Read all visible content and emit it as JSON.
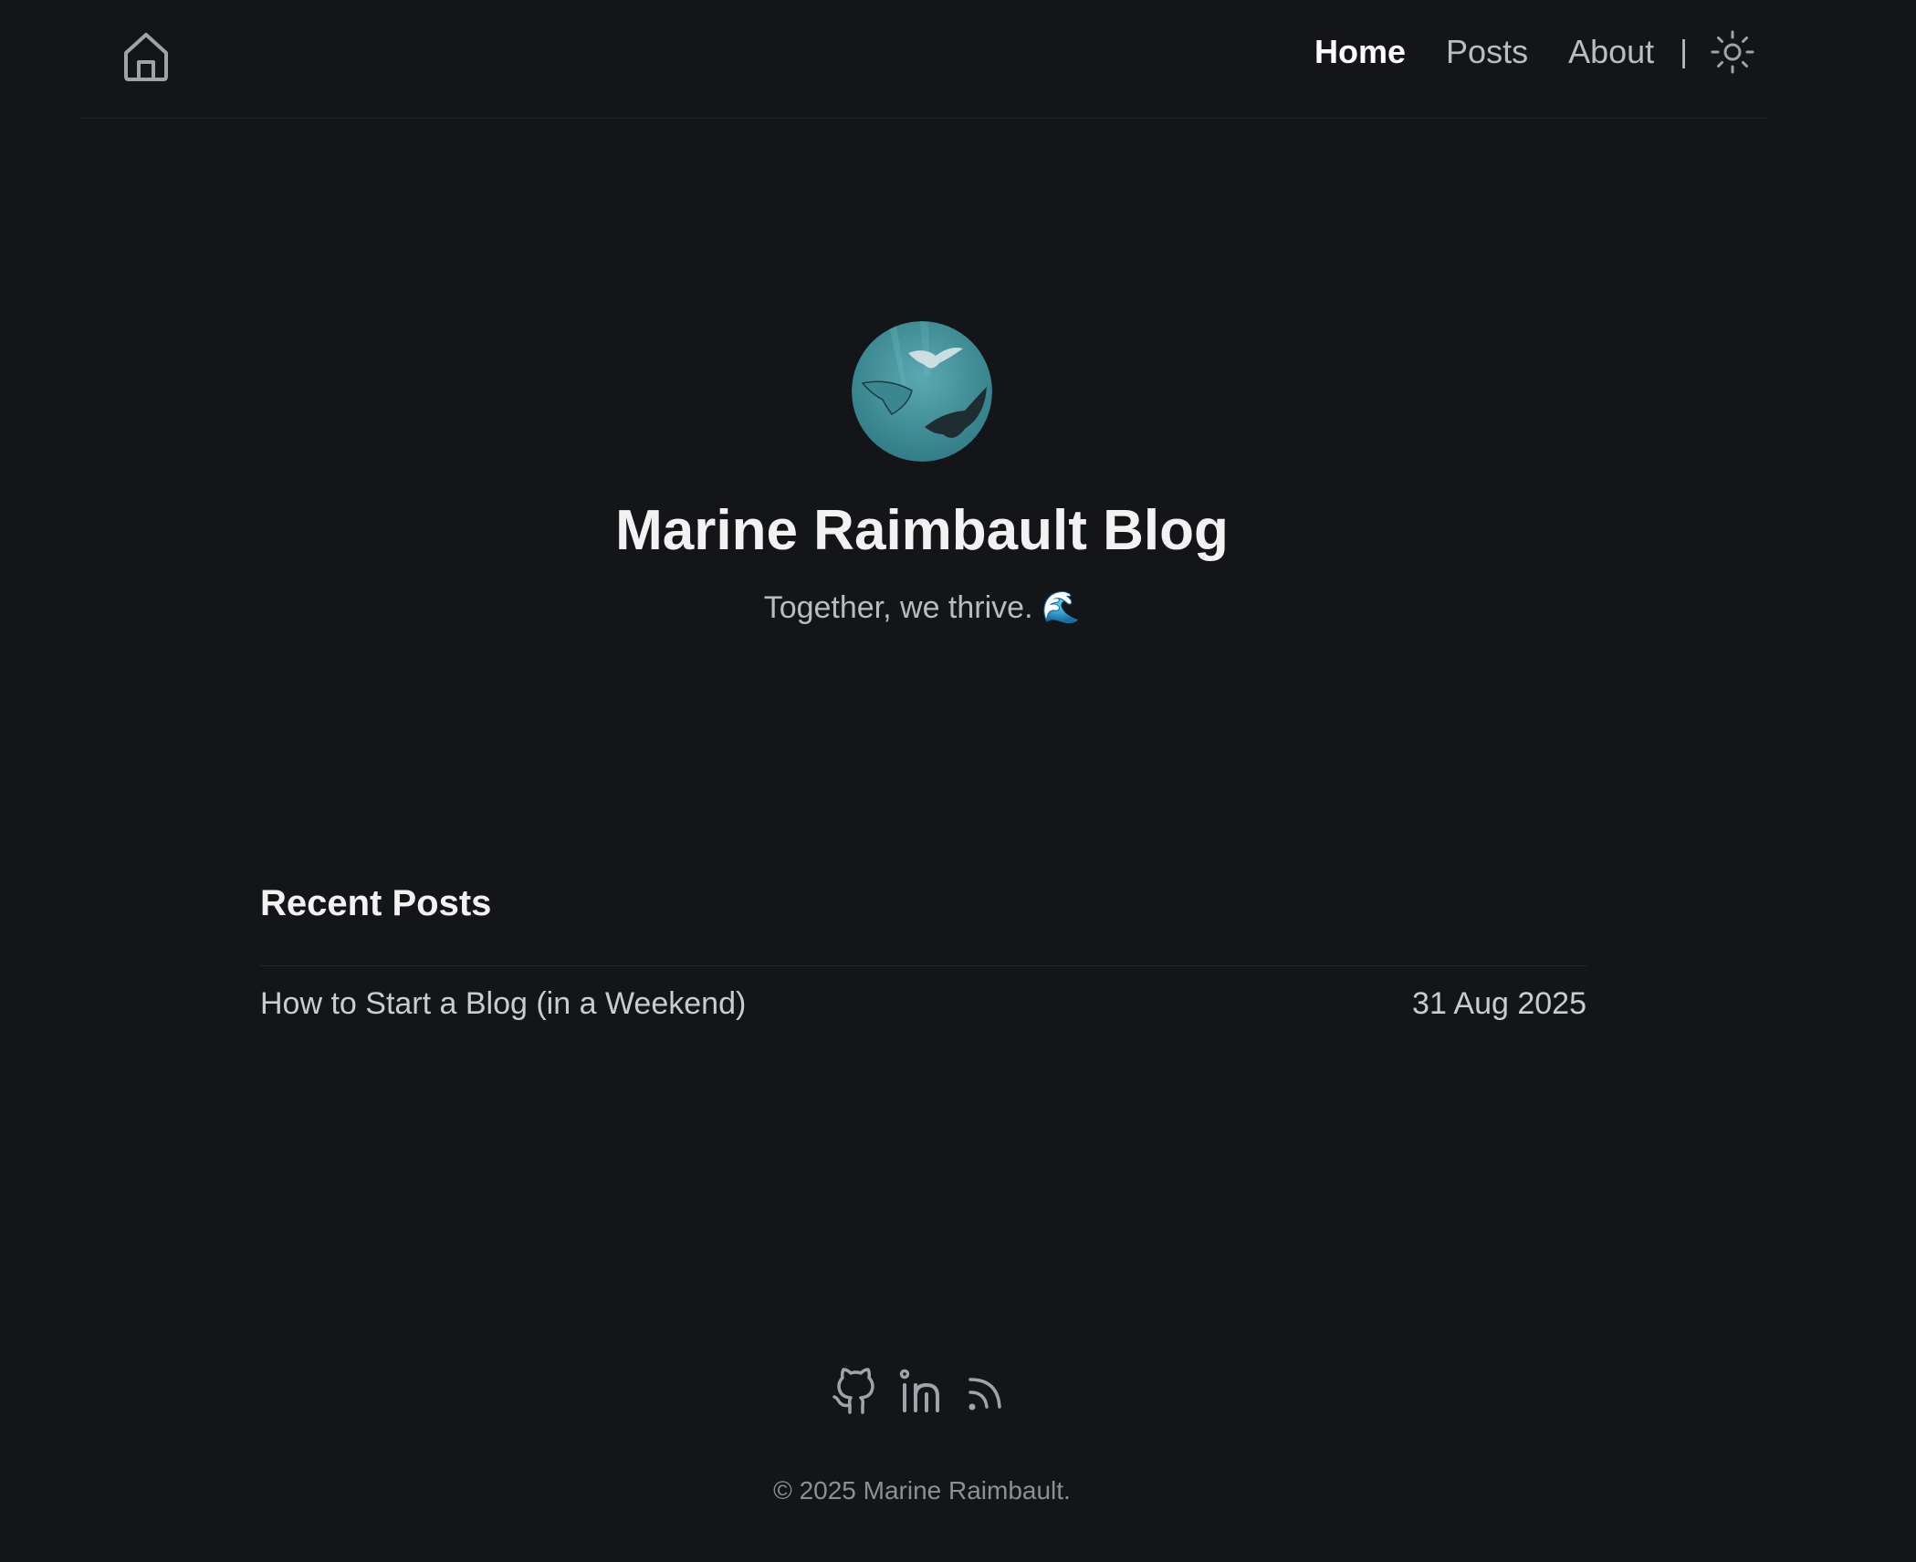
{
  "header": {
    "home_icon": "home-icon",
    "nav": {
      "home": "Home",
      "posts": "Posts",
      "about": "About",
      "separator": "|"
    },
    "theme_icon": "sun-icon"
  },
  "hero": {
    "avatar_alt": "manta rays underwater",
    "title": "Marine Raimbault Blog",
    "subtitle": "Together, we thrive. 🌊"
  },
  "recent_posts": {
    "heading": "Recent Posts",
    "items": [
      {
        "title": "How to Start a Blog (in a Weekend)",
        "date": "31 Aug 2025"
      }
    ]
  },
  "footer": {
    "social_icons": [
      "github-icon",
      "linkedin-icon",
      "rss-icon"
    ],
    "copyright": "© 2025 Marine Raimbault."
  },
  "colors": {
    "background": "#141519",
    "text_primary": "#f2f2f2",
    "text_secondary": "#b9bcc2",
    "icon": "#a0a3a9",
    "avatar_sea": "#3f8f99"
  }
}
